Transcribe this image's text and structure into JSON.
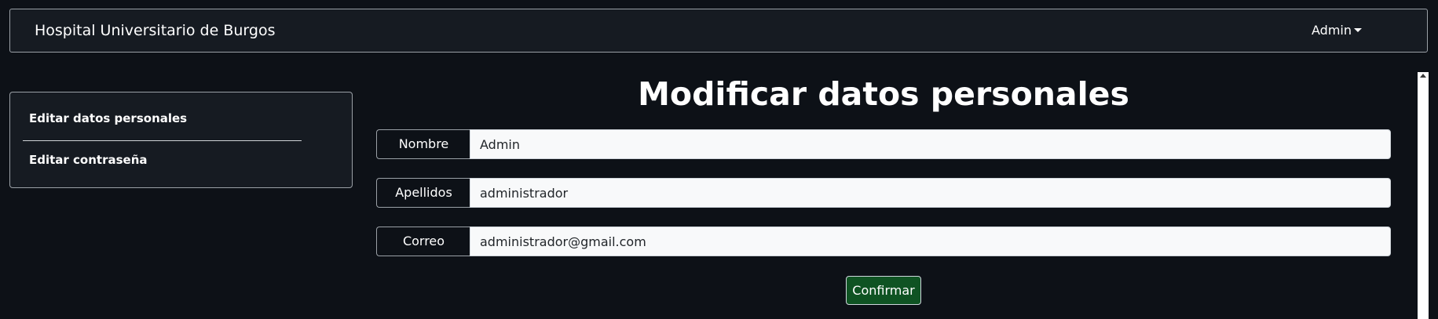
{
  "navbar": {
    "brand": "Hospital Universitario de Burgos",
    "user_menu_label": "Admin"
  },
  "sidebar": {
    "items": [
      {
        "label": "Editar datos personales"
      },
      {
        "label": "Editar contraseña"
      }
    ]
  },
  "main": {
    "title": "Modificar datos personales",
    "fields": [
      {
        "label": "Nombre",
        "value": "Admin"
      },
      {
        "label": "Apellidos",
        "value": "administrador"
      },
      {
        "label": "Correo",
        "value": "administrador@gmail.com"
      }
    ],
    "confirm_label": "Confirmar"
  },
  "colors": {
    "background": "#0d1117",
    "panel": "#161b22",
    "confirm_button": "#0f5323",
    "input_background": "#f8f9fa"
  }
}
